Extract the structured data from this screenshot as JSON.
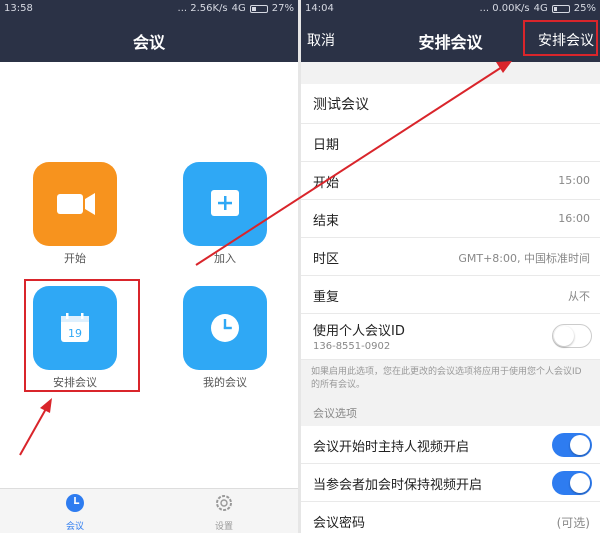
{
  "left": {
    "status": {
      "time": "13:58",
      "network": "... 2.56K/s",
      "signal": "4G",
      "battery": "27%"
    },
    "title": "会议",
    "apps": [
      {
        "label": "开始",
        "icon": "video-camera-icon",
        "color": "#f7931e"
      },
      {
        "label": "加入",
        "icon": "plus-icon",
        "color": "#2fa8f5"
      },
      {
        "label": "安排会议",
        "icon": "calendar-icon",
        "color": "#2fa8f5",
        "calendar_day": "19"
      },
      {
        "label": "我的会议",
        "icon": "clock-icon",
        "color": "#2fa8f5"
      }
    ],
    "tabs": [
      {
        "label": "会议",
        "icon": "clock-icon",
        "active": true
      },
      {
        "label": "设置",
        "icon": "gear-icon",
        "active": false
      }
    ]
  },
  "right": {
    "status": {
      "time": "14:04",
      "network": "... 0.00K/s",
      "signal": "4G",
      "battery": "25%"
    },
    "cancel": "取消",
    "title": "安排会议",
    "schedule": "安排会议",
    "topic": "测试会议",
    "rows": {
      "date": {
        "label": "日期",
        "value": ""
      },
      "start": {
        "label": "开始",
        "value": "15:00"
      },
      "end": {
        "label": "结束",
        "value": "16:00"
      },
      "timezone": {
        "label": "时区",
        "value": "GMT+8:00, 中国标准时间"
      },
      "repeat": {
        "label": "重复",
        "value": "从不"
      }
    },
    "personal_id": {
      "label": "使用个人会议ID",
      "id": "136-8551-0902",
      "enabled": false
    },
    "note": "如果启用此选项，您在此更改的会议选项将应用于使用您个人会议ID的所有会议。",
    "options_title": "会议选项",
    "options": [
      {
        "label": "会议开始时主持人视频开启",
        "enabled": true
      },
      {
        "label": "当参会者加会时保持视频开启",
        "enabled": true
      }
    ],
    "password": {
      "label": "会议密码",
      "value": "(可选)"
    }
  },
  "colors": {
    "header": "#2b3246",
    "accent": "#2e7cf0",
    "highlight": "#d9252b"
  }
}
